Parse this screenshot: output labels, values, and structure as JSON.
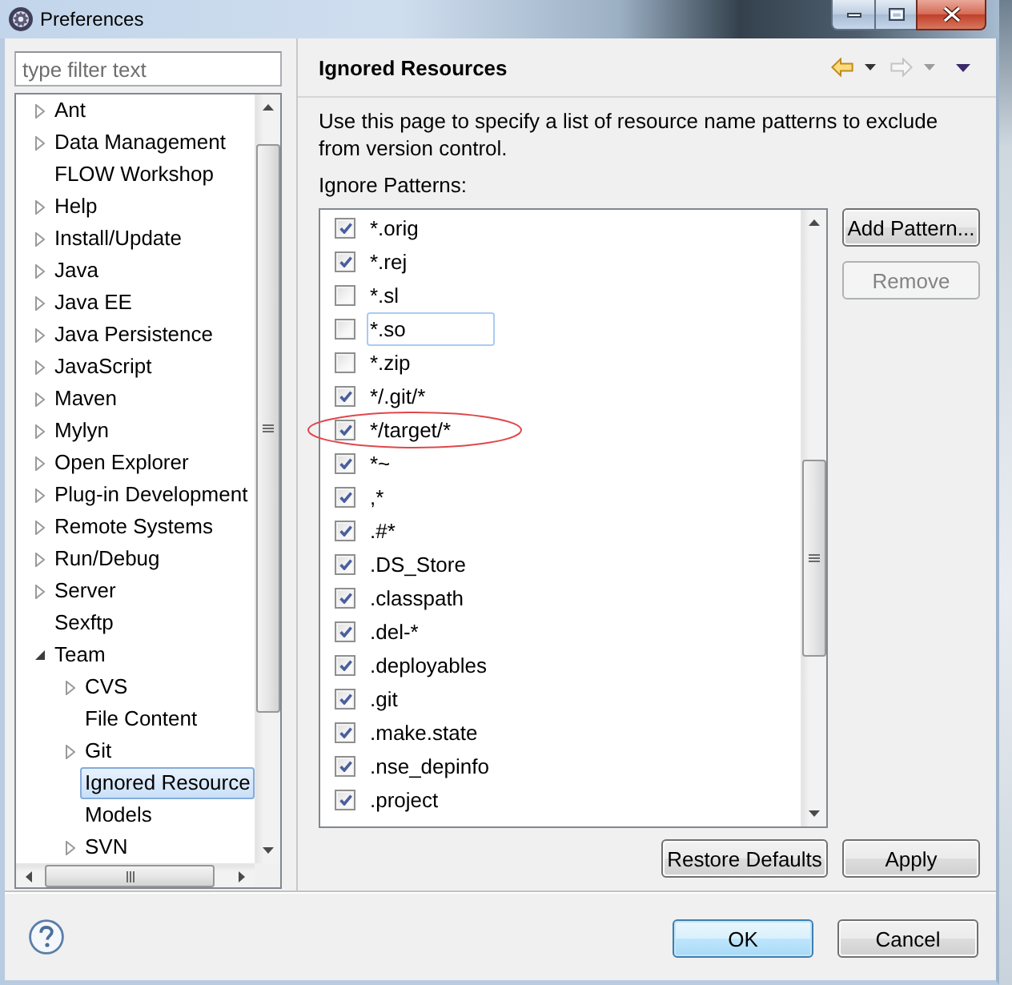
{
  "window": {
    "title": "Preferences"
  },
  "filter": {
    "placeholder": "type filter text"
  },
  "tree": {
    "items": [
      {
        "label": "Ant",
        "kind": "group",
        "expanded": false,
        "selected": false
      },
      {
        "label": "Data Management",
        "kind": "group",
        "expanded": false,
        "selected": false
      },
      {
        "label": "FLOW Workshop",
        "kind": "page",
        "selected": false
      },
      {
        "label": "Help",
        "kind": "group",
        "expanded": false,
        "selected": false
      },
      {
        "label": "Install/Update",
        "kind": "group",
        "expanded": false,
        "selected": false
      },
      {
        "label": "Java",
        "kind": "group",
        "expanded": false,
        "selected": false
      },
      {
        "label": "Java EE",
        "kind": "group",
        "expanded": false,
        "selected": false
      },
      {
        "label": "Java Persistence",
        "kind": "group",
        "expanded": false,
        "selected": false
      },
      {
        "label": "JavaScript",
        "kind": "group",
        "expanded": false,
        "selected": false
      },
      {
        "label": "Maven",
        "kind": "group",
        "expanded": false,
        "selected": false
      },
      {
        "label": "Mylyn",
        "kind": "group",
        "expanded": false,
        "selected": false
      },
      {
        "label": "Open Explorer",
        "kind": "group",
        "expanded": false,
        "selected": false
      },
      {
        "label": "Plug-in Development",
        "kind": "group",
        "expanded": false,
        "selected": false
      },
      {
        "label": "Remote Systems",
        "kind": "group",
        "expanded": false,
        "selected": false
      },
      {
        "label": "Run/Debug",
        "kind": "group",
        "expanded": false,
        "selected": false
      },
      {
        "label": "Server",
        "kind": "group",
        "expanded": false,
        "selected": false
      },
      {
        "label": "Sexftp",
        "kind": "page",
        "selected": false
      },
      {
        "label": "Team",
        "kind": "group",
        "expanded": true,
        "selected": false,
        "children": [
          {
            "label": "CVS",
            "kind": "group",
            "expanded": false,
            "selected": false
          },
          {
            "label": "File Content",
            "kind": "page",
            "selected": false
          },
          {
            "label": "Git",
            "kind": "group",
            "expanded": false,
            "selected": false
          },
          {
            "label": "Ignored Resource",
            "kind": "page",
            "selected": true
          },
          {
            "label": "Models",
            "kind": "page",
            "selected": false
          },
          {
            "label": "SVN",
            "kind": "group",
            "expanded": false,
            "selected": false
          }
        ]
      }
    ]
  },
  "page": {
    "title": "Ignored Resources",
    "description": "Use this page to specify a list of resource name patterns to exclude from version control.",
    "list_label": "Ignore Patterns:"
  },
  "navigation": {
    "back_enabled": true,
    "forward_enabled": false
  },
  "patterns": [
    {
      "text": "*.orig",
      "checked": true,
      "focused": false,
      "circled": false
    },
    {
      "text": "*.rej",
      "checked": true,
      "focused": false,
      "circled": false
    },
    {
      "text": "*.sl",
      "checked": false,
      "focused": false,
      "circled": false
    },
    {
      "text": "*.so",
      "checked": false,
      "focused": true,
      "circled": false
    },
    {
      "text": "*.zip",
      "checked": false,
      "focused": false,
      "circled": false
    },
    {
      "text": "*/.git/*",
      "checked": true,
      "focused": false,
      "circled": false
    },
    {
      "text": "*/target/*",
      "checked": true,
      "focused": false,
      "circled": true
    },
    {
      "text": "*~",
      "checked": true,
      "focused": false,
      "circled": false
    },
    {
      "text": ",*",
      "checked": true,
      "focused": false,
      "circled": false
    },
    {
      "text": ".#*",
      "checked": true,
      "focused": false,
      "circled": false
    },
    {
      "text": ".DS_Store",
      "checked": true,
      "focused": false,
      "circled": false
    },
    {
      "text": ".classpath",
      "checked": true,
      "focused": false,
      "circled": false
    },
    {
      "text": ".del-*",
      "checked": true,
      "focused": false,
      "circled": false
    },
    {
      "text": ".deployables",
      "checked": true,
      "focused": false,
      "circled": false
    },
    {
      "text": ".git",
      "checked": true,
      "focused": false,
      "circled": false
    },
    {
      "text": ".make.state",
      "checked": true,
      "focused": false,
      "circled": false
    },
    {
      "text": ".nse_depinfo",
      "checked": true,
      "focused": false,
      "circled": false
    },
    {
      "text": ".project",
      "checked": true,
      "focused": false,
      "circled": false
    }
  ],
  "pattern_buttons": [
    {
      "label": "Add Pattern...",
      "disabled": false
    },
    {
      "label": "Remove",
      "disabled": true
    }
  ],
  "page_buttons": [
    {
      "label": "Restore Defaults"
    },
    {
      "label": "Apply"
    }
  ],
  "dialog_buttons": [
    {
      "label": "OK",
      "default": true
    },
    {
      "label": "Cancel",
      "default": false
    }
  ]
}
